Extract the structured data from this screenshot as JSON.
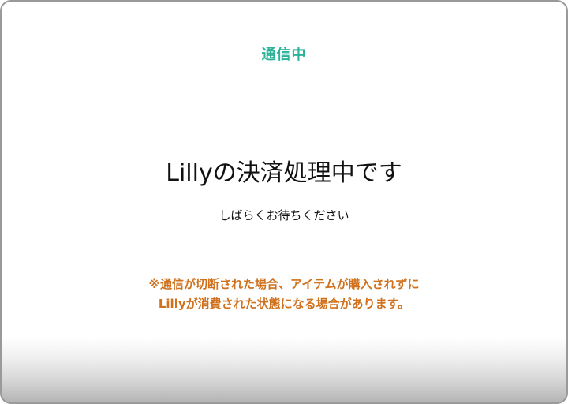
{
  "dialog": {
    "status_label": "通信中",
    "title": "Lillyの決済処理中です",
    "subtitle": "しばらくお待ちください",
    "warning_lines": [
      "※通信が切断された場合、アイテムが購入されずに",
      "Lillyが消費された状態になる場合があります。"
    ]
  },
  "colors": {
    "status": "#2bb39a",
    "warning": "#d0711d",
    "text": "#111111",
    "border": "#9a9a9a"
  }
}
